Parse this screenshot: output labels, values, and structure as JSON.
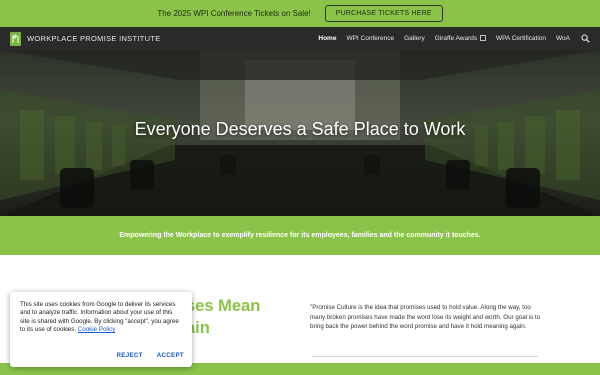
{
  "announcement": {
    "text": "The 2025 WPI Conference Tickets on Sale!",
    "button_label": "PURCHASE TICKETS HERE"
  },
  "header": {
    "site_title": "WORKPLACE PROMISE INSTITUTE",
    "logo_icon": "wpi-logo-icon",
    "nav": [
      {
        "label": "Home",
        "active": true
      },
      {
        "label": "WPI Conference",
        "active": false
      },
      {
        "label": "Gallery",
        "active": false
      },
      {
        "label": "Giraffe Awards",
        "active": false,
        "icon": "external-link-icon"
      },
      {
        "label": "WPA Certification",
        "active": false
      },
      {
        "label": "WoA",
        "active": false
      }
    ],
    "search_icon": "search-icon"
  },
  "hero": {
    "title": "Everyone Deserves a Safe Place to Work"
  },
  "tagline": {
    "text": "Empowering the Workplace to exemplify resilience for its employees, families and the community it touches."
  },
  "content": {
    "heading_line1": "ses Mean",
    "heading_line2": "ain",
    "body": "\"Promise Culture is the idea that promises used to hold value. Along the way, too many broken promises have made the word lose its weight and worth. Our goal is to bring back the power behind the word promise and have it hold meaning again."
  },
  "cookie": {
    "text": "This site uses cookies from Google to deliver its services and to analyze traffic. Information about your use of this site is shared with Google. By clicking \"accept\", you agree to its use of cookies.",
    "link_label": "Cookie Policy",
    "reject_label": "REJECT",
    "accept_label": "ACCEPT"
  },
  "colors": {
    "brand_green": "#8bc34a",
    "header_dark": "#2a2a2a",
    "link_blue": "#1a56d6"
  }
}
